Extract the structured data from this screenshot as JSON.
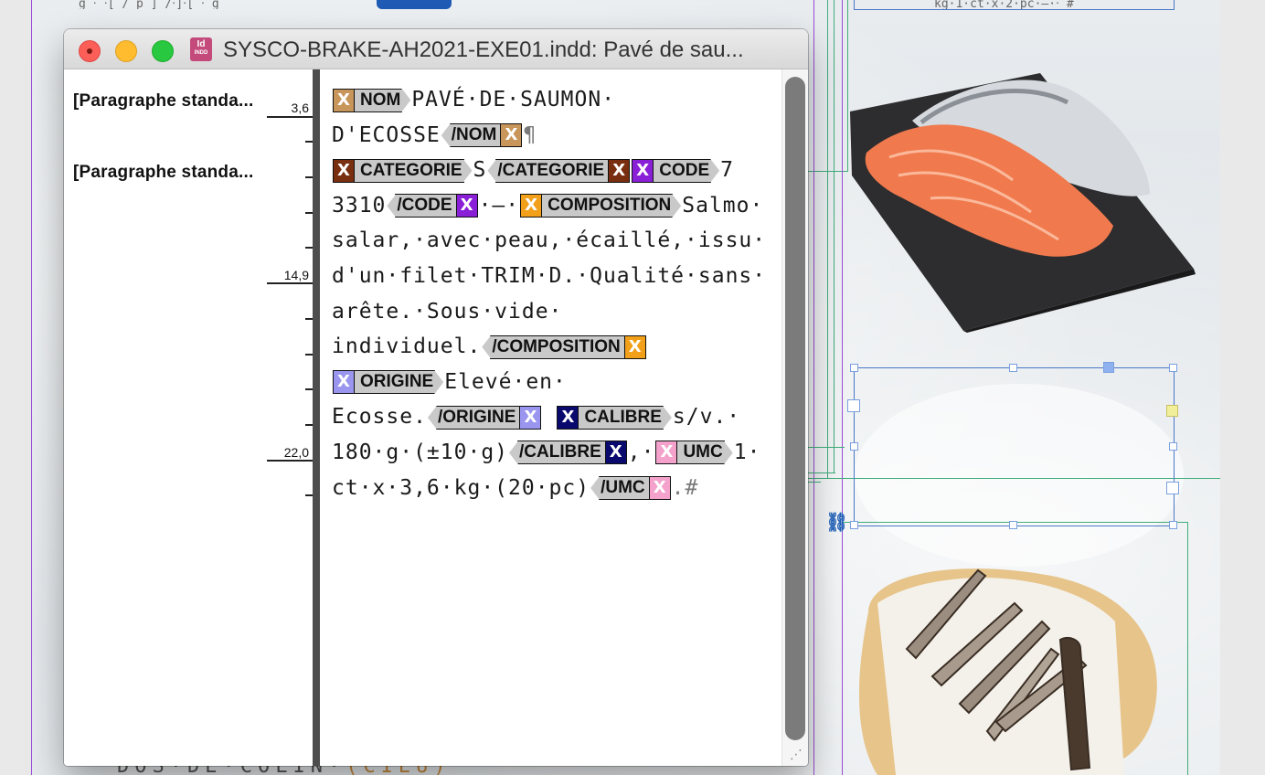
{
  "window": {
    "title": "SYSCO-BRAKE-AH2021-EXE01.indd: Pavé de sau...",
    "app_icon_label": "Id",
    "app_icon_sub": "INDD"
  },
  "styles": [
    {
      "name": "[Paragraphe standa..."
    },
    {
      "name": "[Paragraphe standa..."
    }
  ],
  "depth_markers": [
    "3,6",
    "14,9",
    "22,0"
  ],
  "story_lines": {
    "l1_text": "PAVÉ·DE·SAUMON·",
    "l2_text": "D'ECOSSE",
    "l3_s": "S",
    "l3_7": "7",
    "l4_3310": "3310",
    "l4_dash": "·—·",
    "l4_salmo": "Salmo·",
    "l5": "salar,·avec·peau,·écaillé,·issu·",
    "l6": "d'un·filet·TRIM·D.·Qualité·sans·",
    "l7": "arête.·Sous·vide·",
    "l8": "individuel.",
    "l9": "Elevé·en·",
    "l10": "Ecosse.",
    "l10_tail": "s/v.·",
    "l11": "180·g·(±10·g)",
    "l11_comma": ",·",
    "l11_tail": "1·",
    "l12": "ct·x·3,6·kg·(20·pc)",
    "l12_end": ".#",
    "pilcrow": "¶"
  },
  "tags": {
    "nom": {
      "name": "NOM",
      "close": "/NOM",
      "color": "#c8955a"
    },
    "categorie": {
      "name": "CATEGORIE",
      "close": "/CATEGORIE",
      "color": "#7a2e10"
    },
    "code": {
      "name": "CODE",
      "close": "/CODE",
      "color": "#8a1fd8"
    },
    "composition": {
      "name": "COMPOSITION",
      "close": "/COMPOSITION",
      "color": "#f2a01a"
    },
    "origine": {
      "name": "ORIGINE",
      "close": "/ORIGINE",
      "color": "#9a96f0"
    },
    "calibre": {
      "name": "CALIBRE",
      "close": "/CALIBRE",
      "color": "#0a0a6e"
    },
    "umc": {
      "name": "UMC",
      "close": "/UMC",
      "color": "#f4a2cc"
    }
  },
  "tag_marker": "X",
  "background_layout": {
    "bottom_text": "DOS·DE·COLIN·",
    "bottom_text_tail": "(CIEU)"
  }
}
